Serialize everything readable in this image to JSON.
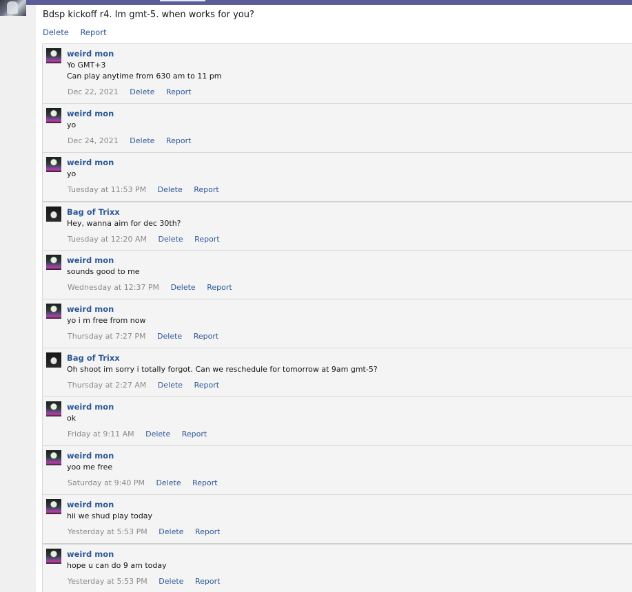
{
  "op": {
    "text": "Bdsp kickoff r4. Im gmt-5. when works for you?",
    "delete_label": "Delete",
    "report_label": "Report"
  },
  "replies": [
    {
      "author": "weird mon",
      "avatar": "weird-mon-avatar",
      "body": "Yo GMT+3\nCan play anytime from 630 am to 11 pm",
      "time": "Dec 22, 2021",
      "delete": "Delete",
      "report": "Report"
    },
    {
      "author": "weird mon",
      "avatar": "weird-mon-avatar",
      "body": "yo",
      "time": "Dec 24, 2021",
      "delete": "Delete",
      "report": "Report"
    },
    {
      "author": "weird mon",
      "avatar": "weird-mon-avatar",
      "body": "yo",
      "time": "Tuesday at 11:53 PM",
      "delete": "Delete",
      "report": "Report"
    },
    {
      "author": "Bag of Trixx",
      "avatar": "bag-of-trixx-avatar",
      "body": "Hey, wanna aim for dec 30th?",
      "time": "Tuesday at 12:20 AM",
      "delete": "Delete",
      "report": "Report"
    },
    {
      "author": "weird mon",
      "avatar": "weird-mon-avatar",
      "body": "sounds good to me",
      "time": "Wednesday at 12:37 PM",
      "delete": "Delete",
      "report": "Report"
    },
    {
      "author": "weird mon",
      "avatar": "weird-mon-avatar",
      "body": "yo i m free from now",
      "time": "Thursday at 7:27 PM",
      "delete": "Delete",
      "report": "Report"
    },
    {
      "author": "Bag of Trixx",
      "avatar": "bag-of-trixx-avatar",
      "body": "Oh shoot im sorry i totally forgot. Can we reschedule for tomorrow at 9am gmt-5?",
      "time": "Thursday at 2:27 AM",
      "delete": "Delete",
      "report": "Report"
    },
    {
      "author": "weird mon",
      "avatar": "weird-mon-avatar",
      "body": "ok",
      "time": "Friday at 9:11 AM",
      "delete": "Delete",
      "report": "Report"
    },
    {
      "author": "weird mon",
      "avatar": "weird-mon-avatar",
      "body": "yoo me free",
      "time": "Saturday at 9:40 PM",
      "delete": "Delete",
      "report": "Report"
    },
    {
      "author": "weird mon",
      "avatar": "weird-mon-avatar",
      "body": "hii we shud play today",
      "time": "Yesterday at 5:53 PM",
      "delete": "Delete",
      "report": "Report"
    },
    {
      "author": "weird mon",
      "avatar": "weird-mon-avatar",
      "body": "hope u can do 9 am today",
      "time": "Yesterday at 5:53 PM",
      "delete": "Delete",
      "report": "Report"
    }
  ],
  "colors": {
    "link": "#2b5797",
    "reply_bg": "#f4f4f4",
    "meta": "#8a8a8a",
    "topbar": "#5c5c9a"
  }
}
